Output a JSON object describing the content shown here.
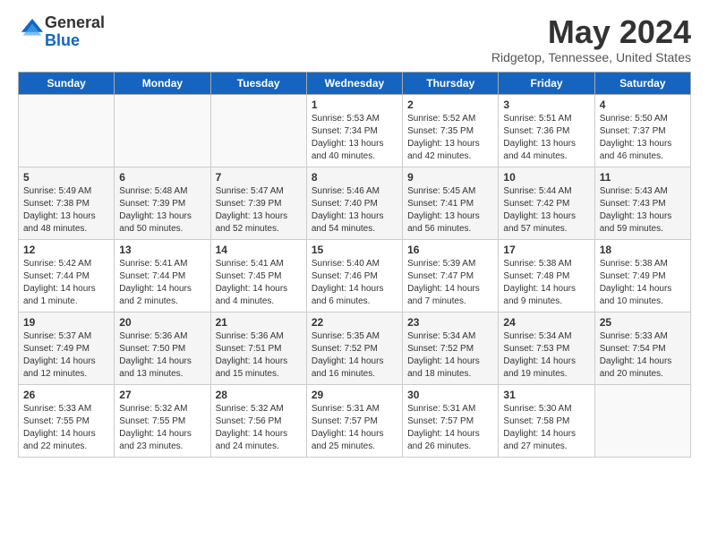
{
  "logo": {
    "general": "General",
    "blue": "Blue"
  },
  "title": "May 2024",
  "subtitle": "Ridgetop, Tennessee, United States",
  "weekdays": [
    "Sunday",
    "Monday",
    "Tuesday",
    "Wednesday",
    "Thursday",
    "Friday",
    "Saturday"
  ],
  "weeks": [
    [
      {
        "day": "",
        "info": ""
      },
      {
        "day": "",
        "info": ""
      },
      {
        "day": "",
        "info": ""
      },
      {
        "day": "1",
        "info": "Sunrise: 5:53 AM\nSunset: 7:34 PM\nDaylight: 13 hours and 40 minutes."
      },
      {
        "day": "2",
        "info": "Sunrise: 5:52 AM\nSunset: 7:35 PM\nDaylight: 13 hours and 42 minutes."
      },
      {
        "day": "3",
        "info": "Sunrise: 5:51 AM\nSunset: 7:36 PM\nDaylight: 13 hours and 44 minutes."
      },
      {
        "day": "4",
        "info": "Sunrise: 5:50 AM\nSunset: 7:37 PM\nDaylight: 13 hours and 46 minutes."
      }
    ],
    [
      {
        "day": "5",
        "info": "Sunrise: 5:49 AM\nSunset: 7:38 PM\nDaylight: 13 hours and 48 minutes."
      },
      {
        "day": "6",
        "info": "Sunrise: 5:48 AM\nSunset: 7:39 PM\nDaylight: 13 hours and 50 minutes."
      },
      {
        "day": "7",
        "info": "Sunrise: 5:47 AM\nSunset: 7:39 PM\nDaylight: 13 hours and 52 minutes."
      },
      {
        "day": "8",
        "info": "Sunrise: 5:46 AM\nSunset: 7:40 PM\nDaylight: 13 hours and 54 minutes."
      },
      {
        "day": "9",
        "info": "Sunrise: 5:45 AM\nSunset: 7:41 PM\nDaylight: 13 hours and 56 minutes."
      },
      {
        "day": "10",
        "info": "Sunrise: 5:44 AM\nSunset: 7:42 PM\nDaylight: 13 hours and 57 minutes."
      },
      {
        "day": "11",
        "info": "Sunrise: 5:43 AM\nSunset: 7:43 PM\nDaylight: 13 hours and 59 minutes."
      }
    ],
    [
      {
        "day": "12",
        "info": "Sunrise: 5:42 AM\nSunset: 7:44 PM\nDaylight: 14 hours and 1 minute."
      },
      {
        "day": "13",
        "info": "Sunrise: 5:41 AM\nSunset: 7:44 PM\nDaylight: 14 hours and 2 minutes."
      },
      {
        "day": "14",
        "info": "Sunrise: 5:41 AM\nSunset: 7:45 PM\nDaylight: 14 hours and 4 minutes."
      },
      {
        "day": "15",
        "info": "Sunrise: 5:40 AM\nSunset: 7:46 PM\nDaylight: 14 hours and 6 minutes."
      },
      {
        "day": "16",
        "info": "Sunrise: 5:39 AM\nSunset: 7:47 PM\nDaylight: 14 hours and 7 minutes."
      },
      {
        "day": "17",
        "info": "Sunrise: 5:38 AM\nSunset: 7:48 PM\nDaylight: 14 hours and 9 minutes."
      },
      {
        "day": "18",
        "info": "Sunrise: 5:38 AM\nSunset: 7:49 PM\nDaylight: 14 hours and 10 minutes."
      }
    ],
    [
      {
        "day": "19",
        "info": "Sunrise: 5:37 AM\nSunset: 7:49 PM\nDaylight: 14 hours and 12 minutes."
      },
      {
        "day": "20",
        "info": "Sunrise: 5:36 AM\nSunset: 7:50 PM\nDaylight: 14 hours and 13 minutes."
      },
      {
        "day": "21",
        "info": "Sunrise: 5:36 AM\nSunset: 7:51 PM\nDaylight: 14 hours and 15 minutes."
      },
      {
        "day": "22",
        "info": "Sunrise: 5:35 AM\nSunset: 7:52 PM\nDaylight: 14 hours and 16 minutes."
      },
      {
        "day": "23",
        "info": "Sunrise: 5:34 AM\nSunset: 7:52 PM\nDaylight: 14 hours and 18 minutes."
      },
      {
        "day": "24",
        "info": "Sunrise: 5:34 AM\nSunset: 7:53 PM\nDaylight: 14 hours and 19 minutes."
      },
      {
        "day": "25",
        "info": "Sunrise: 5:33 AM\nSunset: 7:54 PM\nDaylight: 14 hours and 20 minutes."
      }
    ],
    [
      {
        "day": "26",
        "info": "Sunrise: 5:33 AM\nSunset: 7:55 PM\nDaylight: 14 hours and 22 minutes."
      },
      {
        "day": "27",
        "info": "Sunrise: 5:32 AM\nSunset: 7:55 PM\nDaylight: 14 hours and 23 minutes."
      },
      {
        "day": "28",
        "info": "Sunrise: 5:32 AM\nSunset: 7:56 PM\nDaylight: 14 hours and 24 minutes."
      },
      {
        "day": "29",
        "info": "Sunrise: 5:31 AM\nSunset: 7:57 PM\nDaylight: 14 hours and 25 minutes."
      },
      {
        "day": "30",
        "info": "Sunrise: 5:31 AM\nSunset: 7:57 PM\nDaylight: 14 hours and 26 minutes."
      },
      {
        "day": "31",
        "info": "Sunrise: 5:30 AM\nSunset: 7:58 PM\nDaylight: 14 hours and 27 minutes."
      },
      {
        "day": "",
        "info": ""
      }
    ]
  ]
}
